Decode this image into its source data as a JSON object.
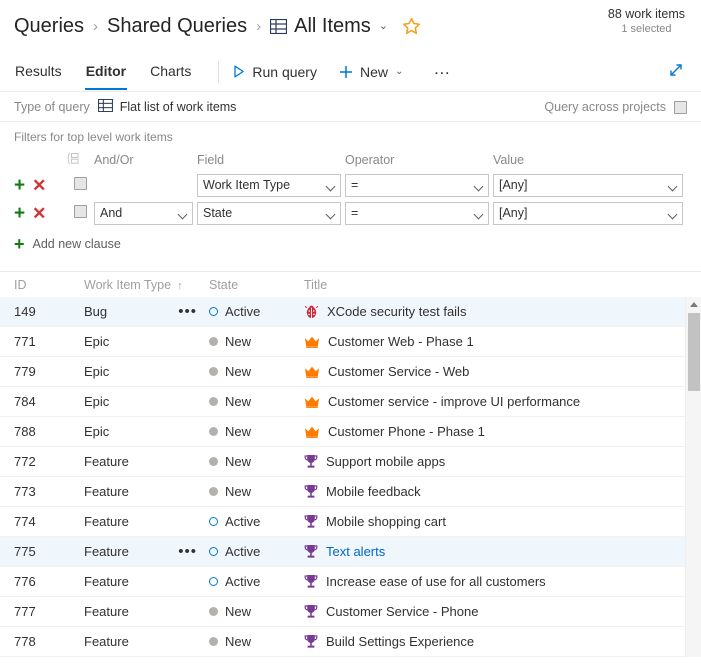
{
  "breadcrumb": {
    "root": "Queries",
    "folder": "Shared Queries",
    "current": "All Items",
    "sep": "›",
    "chevron": "⌄",
    "grid_icon": "grid-icon",
    "star_icon": "favorite-star-icon"
  },
  "status": {
    "count": "88 work items",
    "selected": "1 selected"
  },
  "tabs": [
    {
      "label": "Results",
      "active": false
    },
    {
      "label": "Editor",
      "active": true
    },
    {
      "label": "Charts",
      "active": false
    }
  ],
  "toolbar": {
    "run_query": "Run query",
    "new": "New",
    "new_chevron": "⌄",
    "more": "…",
    "run_icon": "play-triangle-icon",
    "new_icon": "plus-icon",
    "expand_icon": "expand-diagonal-icon"
  },
  "query_type": {
    "label": "Type of query",
    "value": "Flat list of work items",
    "across_label": "Query across projects",
    "across_checked": false
  },
  "filters": {
    "title": "Filters for top level work items",
    "group_icon": "group-clauses-icon",
    "columns": {
      "andor": "And/Or",
      "field": "Field",
      "operator": "Operator",
      "value": "Value"
    },
    "add_clause": "Add new clause",
    "add_icon": "plus-icon",
    "row_plus_icon": "add-clause-icon",
    "row_delete_icon": "delete-clause-icon",
    "rows": [
      {
        "andor": "",
        "field": "Work Item Type",
        "operator": "=",
        "value": "[Any]",
        "checked": false
      },
      {
        "andor": "And",
        "field": "State",
        "operator": "=",
        "value": "[Any]",
        "checked": false
      }
    ]
  },
  "grid": {
    "columns": [
      {
        "label": "ID",
        "sorted": false
      },
      {
        "label": "Work Item Type",
        "sorted": true,
        "sort_arrow": "↑"
      },
      {
        "label": "State",
        "sorted": false
      },
      {
        "label": "Title",
        "sorted": false
      }
    ],
    "rows": [
      {
        "id": "149",
        "type": "Bug",
        "state": "Active",
        "title": "XCode security test fails",
        "icon": "bug-icon",
        "selected": true,
        "hover": false,
        "menu": true
      },
      {
        "id": "771",
        "type": "Epic",
        "state": "New",
        "title": "Customer Web - Phase 1",
        "icon": "crown-icon",
        "selected": false,
        "hover": false,
        "menu": false
      },
      {
        "id": "779",
        "type": "Epic",
        "state": "New",
        "title": "Customer Service - Web",
        "icon": "crown-icon",
        "selected": false,
        "hover": false,
        "menu": false
      },
      {
        "id": "784",
        "type": "Epic",
        "state": "New",
        "title": "Customer service - improve UI performance",
        "icon": "crown-icon",
        "selected": false,
        "hover": false,
        "menu": false
      },
      {
        "id": "788",
        "type": "Epic",
        "state": "New",
        "title": "Customer Phone - Phase 1",
        "icon": "crown-icon",
        "selected": false,
        "hover": false,
        "menu": false
      },
      {
        "id": "772",
        "type": "Feature",
        "state": "New",
        "title": "Support mobile apps",
        "icon": "trophy-icon",
        "selected": false,
        "hover": false,
        "menu": false
      },
      {
        "id": "773",
        "type": "Feature",
        "state": "New",
        "title": "Mobile feedback",
        "icon": "trophy-icon",
        "selected": false,
        "hover": false,
        "menu": false
      },
      {
        "id": "774",
        "type": "Feature",
        "state": "Active",
        "title": "Mobile shopping cart",
        "icon": "trophy-icon",
        "selected": false,
        "hover": false,
        "menu": false
      },
      {
        "id": "775",
        "type": "Feature",
        "state": "Active",
        "title": "Text alerts",
        "icon": "trophy-icon",
        "selected": false,
        "hover": true,
        "menu": true
      },
      {
        "id": "776",
        "type": "Feature",
        "state": "Active",
        "title": "Increase ease of use for all customers",
        "icon": "trophy-icon",
        "selected": false,
        "hover": false,
        "menu": false
      },
      {
        "id": "777",
        "type": "Feature",
        "state": "New",
        "title": "Customer Service - Phone",
        "icon": "trophy-icon",
        "selected": false,
        "hover": false,
        "menu": false
      },
      {
        "id": "778",
        "type": "Feature",
        "state": "New",
        "title": "Build Settings Experience",
        "icon": "trophy-icon",
        "selected": false,
        "hover": false,
        "menu": false
      }
    ],
    "row_menu_glyph": "•••"
  },
  "colors": {
    "accent": "#0078d4",
    "bug": "#cc293d",
    "epic": "#ff7b00",
    "feature": "#773b93",
    "active_state": "#007acc",
    "new_state": "#b3b0ad",
    "add": "#107c10",
    "delete": "#d13438",
    "star": "#f2a21b",
    "selected_row": "#eff6fc"
  }
}
